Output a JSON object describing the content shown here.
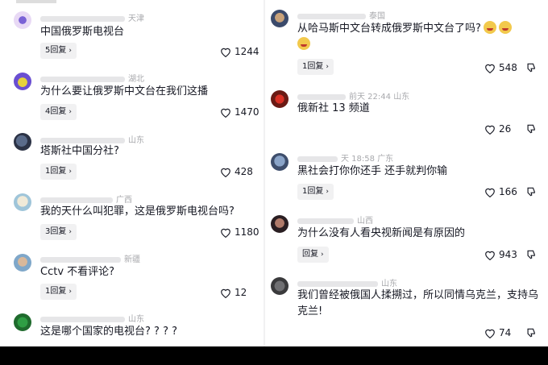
{
  "left": [
    {
      "region": "天津",
      "text": "中国俄罗斯电视台",
      "replies": "5回复",
      "likes": "1244"
    },
    {
      "region": "湖北",
      "text": "为什么要让俄罗斯中文台在我们这播",
      "replies": "4回复",
      "likes": "1470"
    },
    {
      "region": "山东",
      "text": "塔斯社中国分社?",
      "replies": "1回复",
      "likes": "428"
    },
    {
      "region": "广西",
      "text": "我的天什么叫犯罪，这是俄罗斯电视台吗?",
      "replies": "3回复",
      "likes": "1180"
    },
    {
      "region": "新疆",
      "text": "Cctv 不看评论?",
      "replies": "1回复",
      "likes": "12"
    },
    {
      "region": "山东",
      "text": "这是哪个国家的电视台? ? ? ?",
      "replies": "",
      "likes": ""
    }
  ],
  "right": [
    {
      "time": "",
      "region": "泰国",
      "text": "从哈马斯中文台转成俄罗斯中文台了吗?",
      "replies": "1回复",
      "likes": "548"
    },
    {
      "time": "前天 22:44",
      "region": "山东",
      "text": "俄新社 13 频道",
      "replies": "",
      "likes": "26"
    },
    {
      "time": "天 18:58",
      "region": "广东",
      "text": "黑社会打你你还手 还手就判你输",
      "replies": "1回复",
      "likes": "166"
    },
    {
      "time": "",
      "region": "山西",
      "text": "为什么没有人看央视新闻是有原因的",
      "replies": "回复",
      "likes": "943"
    },
    {
      "time": "",
      "region": "山东",
      "text": "我们曾经被俄国人揉搠过，所以同情乌克兰，支持乌克兰!",
      "replies": "",
      "likes": "74"
    }
  ],
  "colors": {
    "reply_bg": "#f1f1f2",
    "meta": "#a8a9ad",
    "text": "#161823"
  },
  "icons": {
    "like": "heart-outline-icon",
    "dislike": "dislike-icon",
    "reply_arrow": "chevron-right-icon"
  }
}
